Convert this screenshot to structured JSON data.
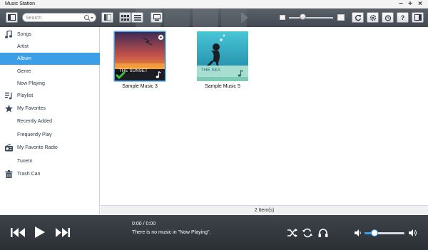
{
  "window": {
    "title": "Music Station"
  },
  "toolbar": {
    "search_placeholder": "Search",
    "view_buttons": [
      "list-view",
      "grid-view",
      "detail-view"
    ]
  },
  "sidebar": {
    "items": [
      {
        "label": "Songs",
        "icon": "music-note-icon",
        "selected": false
      },
      {
        "label": "Artist",
        "icon": "",
        "selected": false
      },
      {
        "label": "Album",
        "icon": "",
        "selected": true
      },
      {
        "label": "Genre",
        "icon": "",
        "selected": false
      },
      {
        "label": "Now Playing",
        "icon": "",
        "selected": false
      },
      {
        "label": "Playlist",
        "icon": "playlist-icon",
        "selected": false
      },
      {
        "label": "My Favorites",
        "icon": "star-icon",
        "selected": false
      },
      {
        "label": "Recently Added",
        "icon": "",
        "selected": false
      },
      {
        "label": "Frequently Play",
        "icon": "",
        "selected": false
      },
      {
        "label": "My Favorite Radio",
        "icon": "radio-icon",
        "selected": false
      },
      {
        "label": "TuneIn",
        "icon": "",
        "selected": false
      },
      {
        "label": "Trash Can",
        "icon": "trash-icon",
        "selected": false
      }
    ]
  },
  "albums": [
    {
      "title": "Sample Music 3",
      "art_label": "THE SUNSET",
      "selected": true
    },
    {
      "title": "Sample Music 5",
      "art_label": "THE SEA",
      "selected": false
    }
  ],
  "status": {
    "item_count": "2 Item(s)"
  },
  "player": {
    "time": "0:00 / 0:00",
    "message": "There is no music in \"Now Playing\"."
  },
  "volume": {
    "level": 0.25
  },
  "zoom": {
    "level": 0.3
  },
  "colors": {
    "accent": "#3c9ee6",
    "toolbar": "#4b5158",
    "player": "#33383e"
  }
}
